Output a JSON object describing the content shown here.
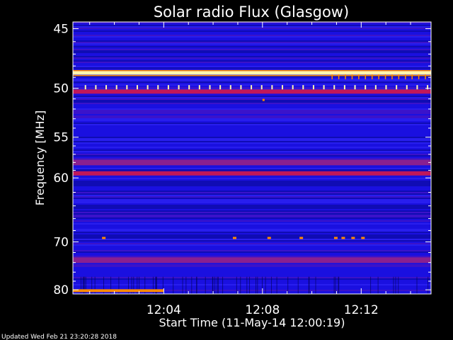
{
  "chart_data": {
    "type": "heatmap",
    "title": "Solar radio Flux (Glasgow)",
    "xlabel": "Start Time (11-May-14 12:00:19)",
    "ylabel": "Frequency [MHz]",
    "x_start": "12:00:19",
    "x_end": "12:14:50",
    "xlim_minutes": [
      0.32,
      14.83
    ],
    "ylim": [
      81,
      44.5
    ],
    "y_scale": "reciprocal",
    "x_ticks": [
      {
        "label": "12:04",
        "minute": 4
      },
      {
        "label": "12:08",
        "minute": 8
      },
      {
        "label": "12:12",
        "minute": 12
      }
    ],
    "y_ticks": [
      {
        "label": "45",
        "value": 45
      },
      {
        "label": "50",
        "value": 50
      },
      {
        "label": "55",
        "value": 55
      },
      {
        "label": "60",
        "value": 60
      },
      {
        "label": "70",
        "value": 70
      },
      {
        "label": "80",
        "value": 80
      }
    ],
    "background_level": "low (blue)",
    "bright_bands_mhz": [
      {
        "freq": 48.6,
        "level": "saturated (yellow-white)"
      },
      {
        "freq": 50.3,
        "level": "high (red)"
      },
      {
        "freq": 58.0,
        "level": "elevated (red/magenta)"
      },
      {
        "freq": 59.4,
        "level": "high (red)"
      },
      {
        "freq": 73.5,
        "level": "elevated (red/magenta)"
      },
      {
        "freq": 80.2,
        "level": "saturated (orange), 12:00–12:04 only"
      }
    ],
    "colors": {
      "low": "#1a10e0",
      "mid": "#c0185a",
      "high": "#ff8a00",
      "max": "#fff6b0"
    }
  },
  "footer": "Updated Wed Feb 21 23:20:28 2018"
}
